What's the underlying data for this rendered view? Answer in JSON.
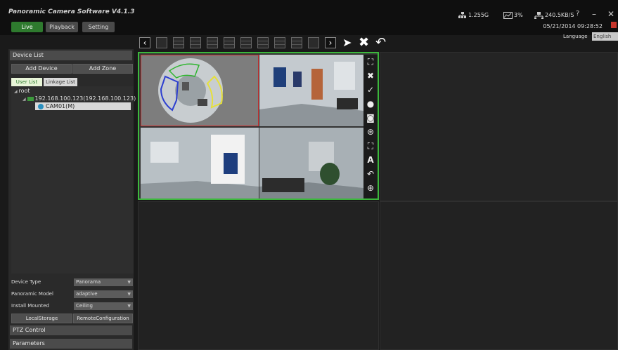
{
  "app": {
    "title": "Panoramic Camera Software V4.1.3"
  },
  "nav": {
    "live": "Live",
    "playback": "Playback",
    "setting": "Setting"
  },
  "stats": {
    "storage": "1.255G",
    "cpu": "3%",
    "network": "240.5KB/S"
  },
  "datetime": "05/21/2014 09:28:52",
  "language": {
    "label": "Language",
    "value": "English"
  },
  "left_panel": {
    "device_list_header": "Device List",
    "add_device": "Add Device",
    "add_zone": "Add Zone",
    "tabs": {
      "user_list": "User List",
      "linkage_list": "Linkage List"
    },
    "tree": {
      "root": "root",
      "device": "192.168.100.123(192.168.100.123)",
      "camera": "CAM01(M)"
    },
    "properties": [
      {
        "label": "Device Type",
        "value": "Panorama"
      },
      {
        "label": "Panoramic Model",
        "value": "adaptive"
      },
      {
        "label": "Install Mounted",
        "value": "Ceiling"
      }
    ],
    "local_storage": "LocalStorage",
    "remote_configuration": "RemoteConfiguration",
    "ptz_control": "PTZ Control",
    "parameters": "Parameters"
  },
  "icons": [
    "network-icon",
    "cpu-icon",
    "transfer-icon",
    "help-icon",
    "minimize-icon",
    "close-icon",
    "prev-icon",
    "next-icon",
    "pointer-icon",
    "delete-icon",
    "rotate-icon",
    "fullscreen-icon",
    "remove-icon",
    "ptz-icon",
    "microphone-icon",
    "snapshot-icon",
    "record-icon",
    "zoom-icon",
    "text-icon",
    "refresh-icon",
    "crosshair-icon",
    "camera-icon"
  ],
  "colors": {
    "accent": "#2e7a2e",
    "active_border": "#3cb83c",
    "selected_sub": "#cc3333"
  }
}
